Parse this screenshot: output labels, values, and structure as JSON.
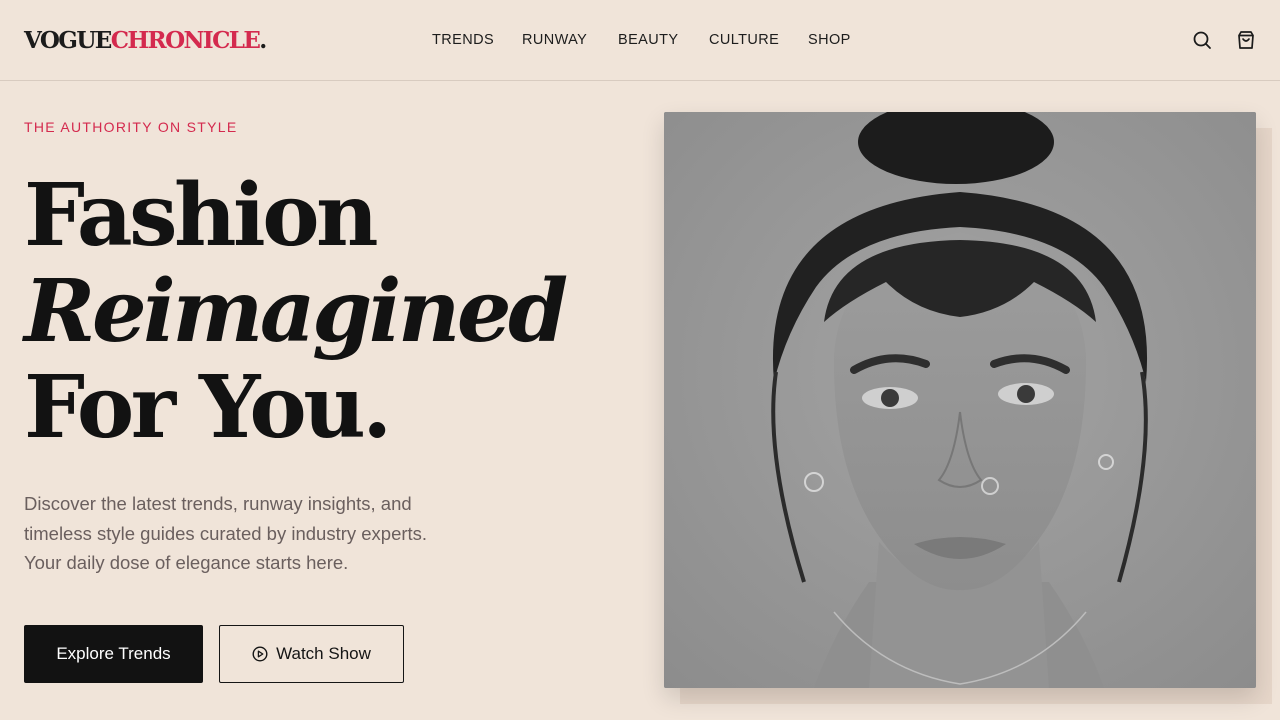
{
  "brand": {
    "part1": "VOGUE",
    "part2": "CHRONICLE",
    "part3": ".",
    "accent_color": "#d42a4e"
  },
  "nav": {
    "items": [
      {
        "label": "TRENDS"
      },
      {
        "label": "RUNWAY"
      },
      {
        "label": "BEAUTY"
      },
      {
        "label": "CULTURE"
      },
      {
        "label": "SHOP"
      }
    ]
  },
  "header_icons": {
    "search": "search-icon",
    "cart": "shopping-bag-icon"
  },
  "hero": {
    "kicker": "THE AUTHORITY ON STYLE",
    "headline": {
      "line1": "Fashion",
      "line2": "Reimagined",
      "line3": "For You."
    },
    "description": {
      "line1": "Discover the latest trends, runway insights, and",
      "line2": "timeless style guides curated by industry experts.",
      "line3": "Your daily dose of elegance starts here."
    },
    "primary_button": "Explore Trends",
    "secondary_button": "Watch Show",
    "secondary_icon": "play-circle-icon",
    "image": "black-and-white portrait"
  },
  "colors": {
    "background": "#f0e4d9",
    "text": "#121212",
    "accent": "#d42a4e",
    "muted": "#6a5f5e"
  }
}
